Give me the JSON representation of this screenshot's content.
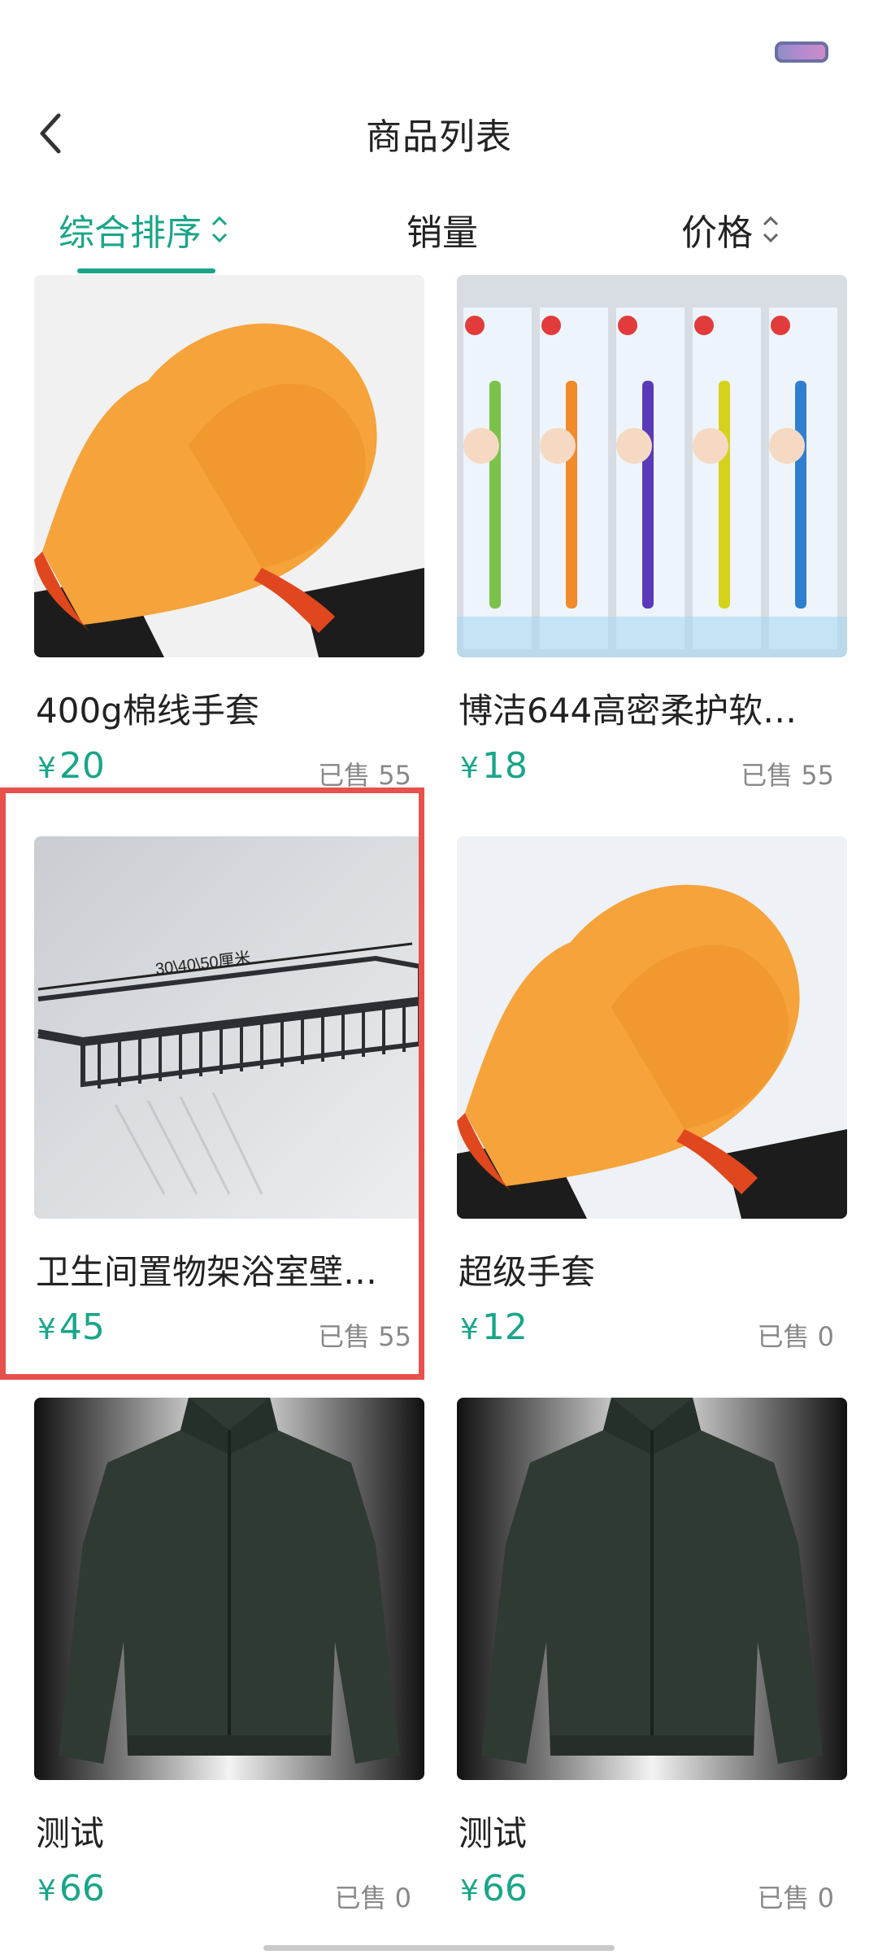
{
  "header": {
    "title": "商品列表"
  },
  "sort": {
    "comprehensive": "综合排序",
    "sales": "销量",
    "price": "价格"
  },
  "colors": {
    "accent": "#1aa58a",
    "highlight": "#e8504c"
  },
  "products": [
    {
      "name": "400g棉线手套",
      "currency": "¥",
      "price": "20",
      "sold": "已售 55",
      "image": "gloves-image"
    },
    {
      "name": "博洁644高密柔护软…",
      "currency": "¥",
      "price": "18",
      "sold": "已售 55",
      "image": "toothbrush-image"
    },
    {
      "name": "卫生间置物架浴室壁…",
      "currency": "¥",
      "price": "45",
      "sold": "已售 55",
      "image": "shelf-image",
      "image_text": "30\\40\\50厘米"
    },
    {
      "name": "超级手套",
      "currency": "¥",
      "price": "12",
      "sold": "已售 0",
      "image": "gloves-image"
    },
    {
      "name": "测试",
      "currency": "¥",
      "price": "66",
      "sold": "已售 0",
      "image": "jacket-image"
    },
    {
      "name": "测试",
      "currency": "¥",
      "price": "66",
      "sold": "已售 0",
      "image": "jacket-image"
    }
  ]
}
